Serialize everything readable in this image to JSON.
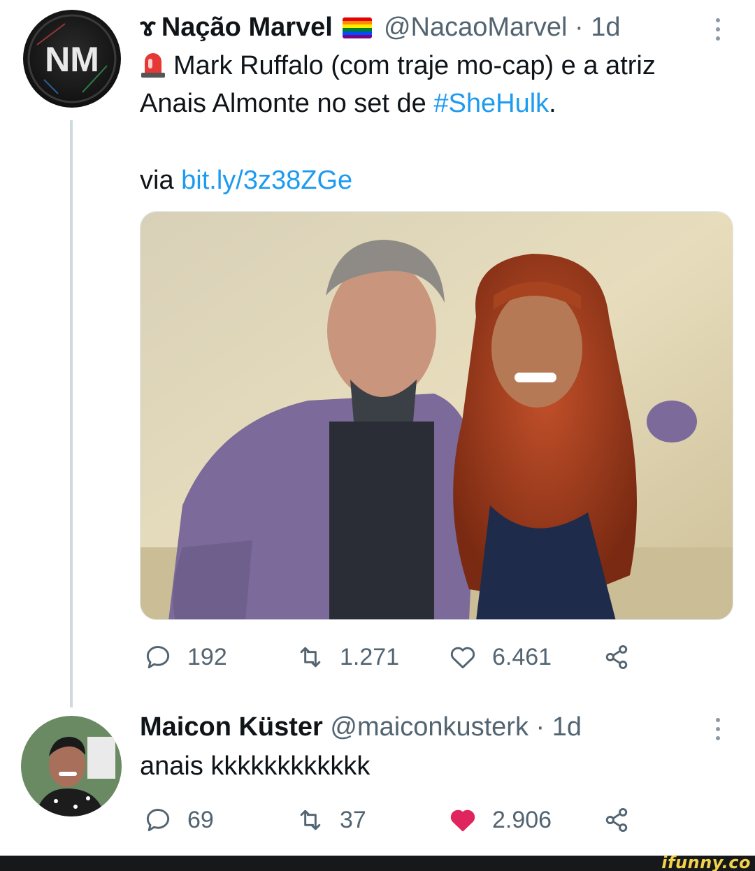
{
  "tweet1": {
    "name": "Nação Marvel",
    "name_prefix": "ɤ",
    "handle": "@NacaoMarvel",
    "separator": "·",
    "time": "1d",
    "line1": "Mark Ruffalo (com traje mo-cap) e a atriz",
    "line2_text": "Anais Almonte no set de ",
    "hashtag": "#SheHulk",
    "line2_end": ".",
    "via_label": "via ",
    "via_link": "bit.ly/3z38ZGe",
    "avatar_text": "NM",
    "stats": {
      "replies": "192",
      "retweets": "1.271",
      "likes": "6.461"
    }
  },
  "tweet2": {
    "name": "Maicon Küster",
    "handle": "@maiconkusterk",
    "separator": "·",
    "time": "1d",
    "text": "anais kkkkkkkkkkkk",
    "stats": {
      "replies": "69",
      "retweets": "37",
      "likes": "2.906"
    }
  },
  "icons": {
    "reply": "speech-bubble-icon",
    "retweet": "retweet-arrows-icon",
    "like": "heart-icon",
    "share": "share-nodes-icon",
    "more": "vertical-ellipsis-icon",
    "siren": "police-light-emoji",
    "flag": "rainbow-flag-emoji"
  },
  "colors": {
    "link": "#1d9bf0",
    "secondary_text": "#536471",
    "liked_heart": "#e0245e",
    "watermark": "#f2d24b"
  },
  "footer": {
    "watermark": "ifunny.co"
  }
}
